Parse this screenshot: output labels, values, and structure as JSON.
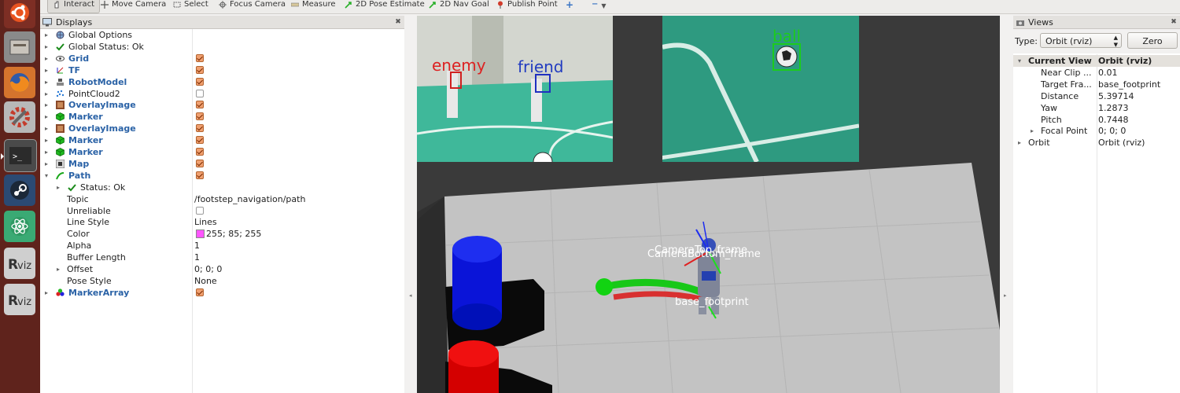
{
  "toolbar": {
    "items": [
      "Interact",
      "Move Camera",
      "Select",
      "Focus Camera",
      "Measure",
      "2D Pose Estimate",
      "2D Nav Goal",
      "Publish Point"
    ]
  },
  "displays": {
    "title": "Displays",
    "rows": [
      {
        "label": "Global Options",
        "value": ""
      },
      {
        "label": "Global Status: Ok",
        "value": ""
      },
      {
        "label": "Grid",
        "value": ""
      },
      {
        "label": "TF",
        "value": ""
      },
      {
        "label": "RobotModel",
        "value": ""
      },
      {
        "label": "PointCloud2",
        "value": ""
      },
      {
        "label": "OverlayImage",
        "value": ""
      },
      {
        "label": "Marker",
        "value": ""
      },
      {
        "label": "OverlayImage",
        "value": ""
      },
      {
        "label": "Marker",
        "value": ""
      },
      {
        "label": "Marker",
        "value": ""
      },
      {
        "label": "Map",
        "value": ""
      },
      {
        "label": "Path",
        "value": ""
      },
      {
        "label": "Status: Ok",
        "value": ""
      },
      {
        "label": "Topic",
        "value": "/footstep_navigation/path"
      },
      {
        "label": "Unreliable",
        "value": ""
      },
      {
        "label": "Line Style",
        "value": "Lines"
      },
      {
        "label": "Color",
        "value": "255; 85; 255"
      },
      {
        "label": "Alpha",
        "value": "1"
      },
      {
        "label": "Buffer Length",
        "value": "1"
      },
      {
        "label": "Offset",
        "value": "0; 0; 0"
      },
      {
        "label": "Pose Style",
        "value": "None"
      },
      {
        "label": "MarkerArray",
        "value": ""
      }
    ]
  },
  "viewport": {
    "left_overlay_labels": [
      "enemy",
      "friend"
    ],
    "right_overlay_label": "ball",
    "tf_labels": [
      "CameraBottom_frame",
      "CameraTop_frame",
      "base_footprint"
    ]
  },
  "views": {
    "title": "Views",
    "type_label": "Type:",
    "type_value": "Orbit (rviz)",
    "zero_label": "Zero",
    "rows": [
      {
        "key": "Current View",
        "value": "Orbit (rviz)"
      },
      {
        "key": "Near Clip ...",
        "value": "0.01"
      },
      {
        "key": "Target Fra...",
        "value": "base_footprint"
      },
      {
        "key": "Distance",
        "value": "5.39714"
      },
      {
        "key": "Yaw",
        "value": "1.2873"
      },
      {
        "key": "Pitch",
        "value": "0.7448"
      },
      {
        "key": "Focal Point",
        "value": "0; 0; 0"
      },
      {
        "key": "Orbit",
        "value": "Orbit (rviz)"
      }
    ]
  },
  "colors": {
    "path_color": "#ff55ff",
    "launcher": "#5f231c"
  }
}
